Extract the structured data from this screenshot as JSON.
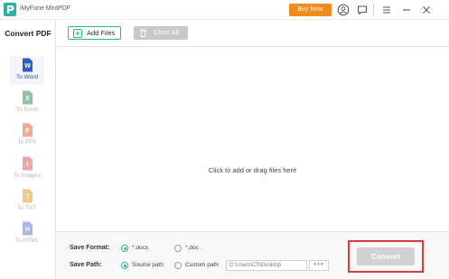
{
  "app": {
    "title": "iMyFone MintPDF",
    "buy_label": "Buy Now"
  },
  "sidebar": {
    "title": "Convert PDF",
    "items": [
      {
        "label": "To Word",
        "letter": "W",
        "color": "#2b5fc4",
        "active": true
      },
      {
        "label": "To Excel",
        "letter": "X",
        "color": "#8fc3a3",
        "active": false
      },
      {
        "label": "To PPT",
        "letter": "P",
        "color": "#f2a892",
        "active": false
      },
      {
        "label": "To Images",
        "letter": "I",
        "color": "#f0a3a8",
        "active": false
      },
      {
        "label": "To TXT",
        "letter": "T",
        "color": "#f2c98a",
        "active": false
      },
      {
        "label": "To HTML",
        "letter": "H",
        "color": "#a8b8e6",
        "active": false
      }
    ]
  },
  "toolbar": {
    "add_label": "Add Files",
    "clear_label": "Clear All"
  },
  "droparea": {
    "hint": "Click to add or drag files here"
  },
  "options": {
    "format_label": "Save Format:",
    "format_options": [
      "*.docx",
      "*.doc"
    ],
    "format_selected": "*.docx",
    "path_label": "Save Path:",
    "path_options": [
      "Source path",
      "Custom path"
    ],
    "path_selected": "Source path",
    "custom_path_value": "C:\\Users\\CS\\Desktop",
    "browse_label": "•••"
  },
  "convert": {
    "label": "Convert"
  },
  "colors": {
    "accent": "#2bb2a6",
    "buy": "#f28b1e",
    "highlight": "#d93a3a"
  }
}
